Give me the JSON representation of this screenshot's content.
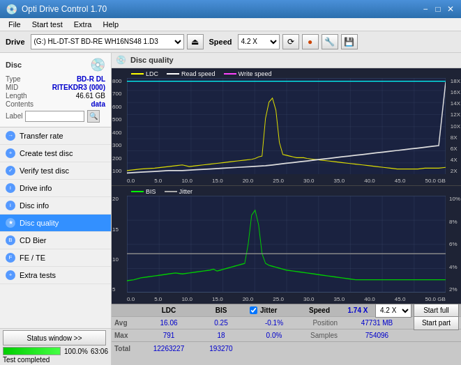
{
  "titlebar": {
    "title": "Opti Drive Control 1.70",
    "min": "−",
    "max": "□",
    "close": "✕"
  },
  "menubar": {
    "items": [
      "File",
      "Start test",
      "Extra",
      "Help"
    ]
  },
  "toolbar": {
    "drive_label": "Drive",
    "drive_value": "(G:) HL-DT-ST BD-RE  WH16NS48 1.D3",
    "speed_label": "Speed",
    "speed_value": "4.2 X"
  },
  "disc_panel": {
    "title": "Disc",
    "type_label": "Type",
    "type_value": "BD-R DL",
    "mid_label": "MID",
    "mid_value": "RITEKDR3 (000)",
    "length_label": "Length",
    "length_value": "46.61 GB",
    "contents_label": "Contents",
    "contents_value": "data",
    "label_label": "Label"
  },
  "nav": {
    "items": [
      {
        "id": "transfer-rate",
        "label": "Transfer rate",
        "active": false
      },
      {
        "id": "create-test-disc",
        "label": "Create test disc",
        "active": false
      },
      {
        "id": "verify-test-disc",
        "label": "Verify test disc",
        "active": false
      },
      {
        "id": "drive-info",
        "label": "Drive info",
        "active": false
      },
      {
        "id": "disc-info",
        "label": "Disc info",
        "active": false
      },
      {
        "id": "disc-quality",
        "label": "Disc quality",
        "active": true
      },
      {
        "id": "cd-bier",
        "label": "CD Bier",
        "active": false
      },
      {
        "id": "fe-te",
        "label": "FE / TE",
        "active": false
      },
      {
        "id": "extra-tests",
        "label": "Extra tests",
        "active": false
      }
    ]
  },
  "status": {
    "btn_label": "Status window >>",
    "progress_pct": 100,
    "progress_text": "100.0%",
    "end_text": "63:06",
    "status_text": "Test completed"
  },
  "content": {
    "title": "Disc quality",
    "chart_top": {
      "legend": [
        {
          "label": "LDC",
          "color": "#ffff00"
        },
        {
          "label": "Read speed",
          "color": "#ffffff"
        },
        {
          "label": "Write speed",
          "color": "#ff44ff"
        }
      ],
      "y_left": [
        "800",
        "700",
        "600",
        "500",
        "400",
        "300",
        "200",
        "100"
      ],
      "y_right": [
        "18X",
        "16X",
        "14X",
        "12X",
        "10X",
        "8X",
        "6X",
        "4X",
        "2X"
      ],
      "x_labels": [
        "0.0",
        "5.0",
        "10.0",
        "15.0",
        "20.0",
        "25.0",
        "30.0",
        "35.0",
        "40.0",
        "45.0",
        "50.0 GB"
      ]
    },
    "chart_bottom": {
      "legend": [
        {
          "label": "BIS",
          "color": "#00ff00"
        },
        {
          "label": "Jitter",
          "color": "#ffffff"
        }
      ],
      "y_left": [
        "20",
        "15",
        "10",
        "5"
      ],
      "y_right": [
        "10%",
        "8%",
        "6%",
        "4%",
        "2%"
      ],
      "x_labels": [
        "0.0",
        "5.0",
        "10.0",
        "15.0",
        "20.0",
        "25.0",
        "30.0",
        "35.0",
        "40.0",
        "45.0",
        "50.0 GB"
      ]
    }
  },
  "stats": {
    "col_ldc": "LDC",
    "col_bis": "BIS",
    "col_jitter": "Jitter",
    "col_speed": "Speed",
    "col_speed_val": "1.74 X",
    "col_speed2": "4.2 X",
    "rows": [
      {
        "label": "Avg",
        "ldc": "16.06",
        "bis": "0.25",
        "jitter": "-0.1%"
      },
      {
        "label": "Max",
        "ldc": "791",
        "bis": "18",
        "jitter": "0.0%"
      },
      {
        "label": "Total",
        "ldc": "12263227",
        "bis": "193270",
        "jitter": ""
      }
    ],
    "position_label": "Position",
    "position_val": "47731 MB",
    "samples_label": "Samples",
    "samples_val": "754096",
    "jitter_checked": true,
    "btn_start_full": "Start full",
    "btn_start_part": "Start part"
  }
}
